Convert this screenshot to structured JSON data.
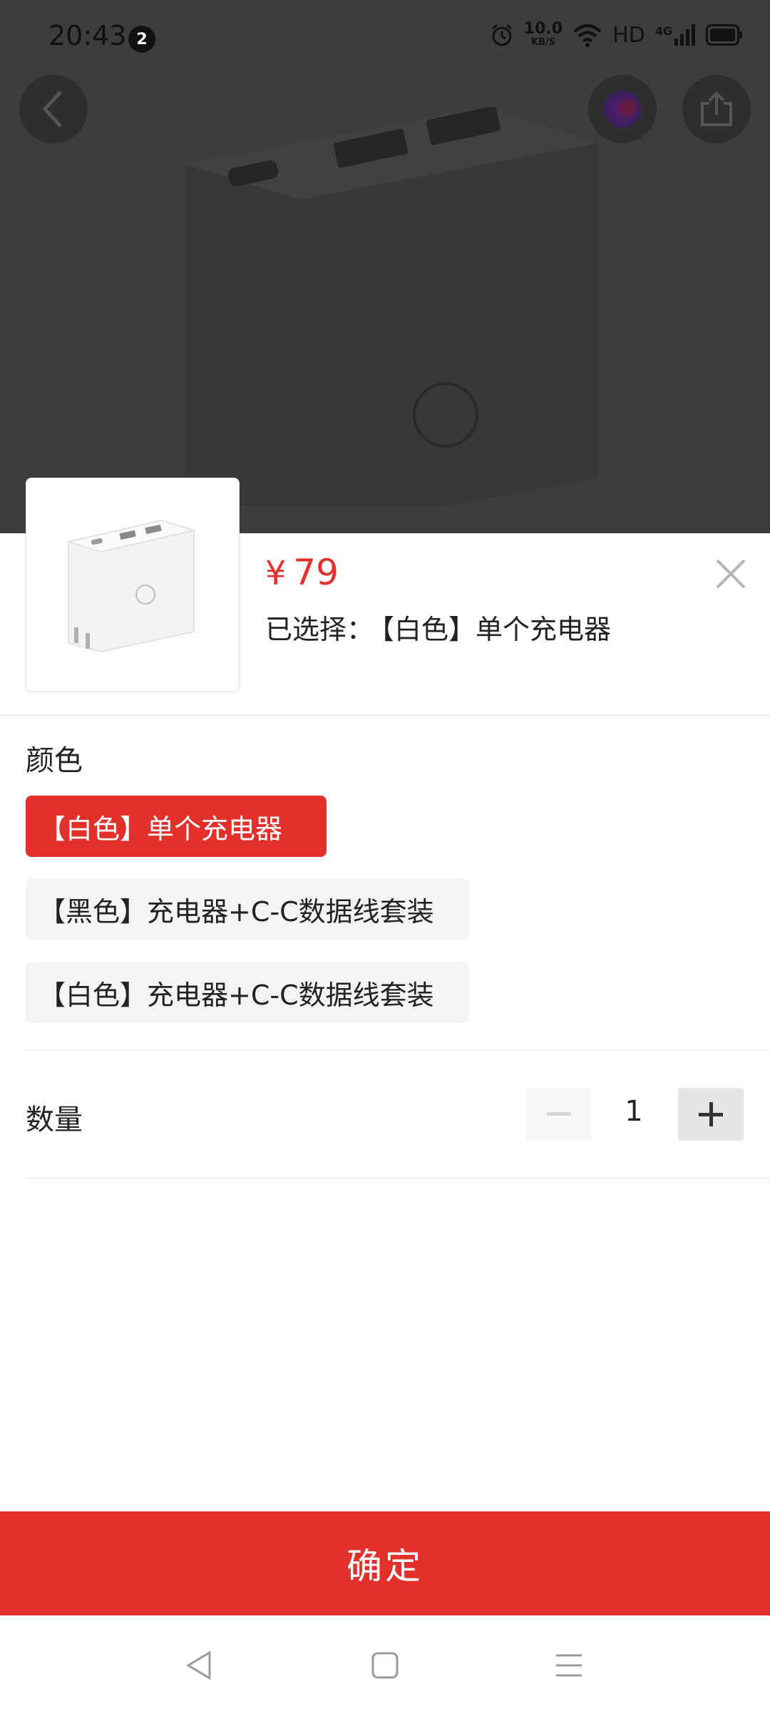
{
  "status_bar": {
    "time": "20:43",
    "notification_count": "2",
    "net_speed_value": "10.0",
    "net_speed_unit": "KB/S",
    "hd_label": "HD",
    "network_label": "4G"
  },
  "icons": {
    "back": "chevron-left-icon",
    "assistant": "colorful-orb-icon",
    "share": "share-icon",
    "close": "close-icon",
    "minus": "minus-icon",
    "plus": "plus-icon",
    "nav_back": "triangle-back-icon",
    "nav_home": "square-home-icon",
    "nav_menu": "hamburger-menu-icon"
  },
  "product": {
    "price_symbol": "¥",
    "price": "79",
    "selected_label": "已选择：",
    "selected_value": "【白色】单个充电器"
  },
  "color_section": {
    "label": "颜色",
    "options": [
      {
        "label": "【白色】单个充电器",
        "selected": true
      },
      {
        "label": "【黑色】充电器+C-C数据线套装",
        "selected": false
      },
      {
        "label": "【白色】充电器+C-C数据线套装",
        "selected": false
      }
    ]
  },
  "quantity_section": {
    "label": "数量",
    "value": "1"
  },
  "confirm_button": {
    "label": "确定"
  },
  "colors": {
    "accent": "#e3302b",
    "inactive_option_bg": "#f4f4f4",
    "backdrop": "#3d3d3d"
  }
}
